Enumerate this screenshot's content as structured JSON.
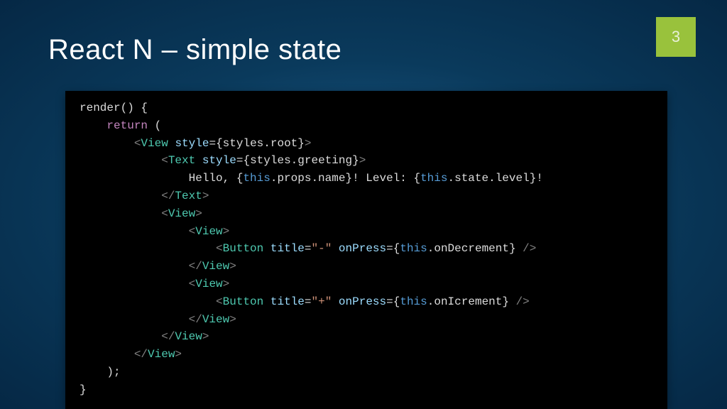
{
  "slide": {
    "title": "React N – simple state",
    "page_number": "3"
  },
  "code": {
    "lines": [
      [
        {
          "t": "render() {",
          "c": "text"
        }
      ],
      [
        {
          "t": "    ",
          "c": "text"
        },
        {
          "t": "return",
          "c": "kw-return"
        },
        {
          "t": " (",
          "c": "text"
        }
      ],
      [
        {
          "t": "        ",
          "c": "text"
        },
        {
          "t": "<",
          "c": "punct"
        },
        {
          "t": "View",
          "c": "component"
        },
        {
          "t": " ",
          "c": "text"
        },
        {
          "t": "style",
          "c": "attr"
        },
        {
          "t": "=",
          "c": "text"
        },
        {
          "t": "{styles.root}",
          "c": "text"
        },
        {
          "t": ">",
          "c": "punct"
        }
      ],
      [
        {
          "t": "            ",
          "c": "text"
        },
        {
          "t": "<",
          "c": "punct"
        },
        {
          "t": "Text",
          "c": "component"
        },
        {
          "t": " ",
          "c": "text"
        },
        {
          "t": "style",
          "c": "attr"
        },
        {
          "t": "=",
          "c": "text"
        },
        {
          "t": "{styles.greeting}",
          "c": "text"
        },
        {
          "t": ">",
          "c": "punct"
        }
      ],
      [
        {
          "t": "                Hello, {",
          "c": "text"
        },
        {
          "t": "this",
          "c": "this"
        },
        {
          "t": ".props.name}! Level: {",
          "c": "text"
        },
        {
          "t": "this",
          "c": "this"
        },
        {
          "t": ".state.level}!",
          "c": "text"
        }
      ],
      [
        {
          "t": "            ",
          "c": "text"
        },
        {
          "t": "</",
          "c": "punct"
        },
        {
          "t": "Text",
          "c": "component"
        },
        {
          "t": ">",
          "c": "punct"
        }
      ],
      [
        {
          "t": "            ",
          "c": "text"
        },
        {
          "t": "<",
          "c": "punct"
        },
        {
          "t": "View",
          "c": "component"
        },
        {
          "t": ">",
          "c": "punct"
        }
      ],
      [
        {
          "t": "                ",
          "c": "text"
        },
        {
          "t": "<",
          "c": "punct"
        },
        {
          "t": "View",
          "c": "component"
        },
        {
          "t": ">",
          "c": "punct"
        }
      ],
      [
        {
          "t": "                    ",
          "c": "text"
        },
        {
          "t": "<",
          "c": "punct"
        },
        {
          "t": "Button",
          "c": "component"
        },
        {
          "t": " ",
          "c": "text"
        },
        {
          "t": "title",
          "c": "attr"
        },
        {
          "t": "=",
          "c": "text"
        },
        {
          "t": "\"-\"",
          "c": "string"
        },
        {
          "t": " ",
          "c": "text"
        },
        {
          "t": "onPress",
          "c": "attr"
        },
        {
          "t": "=",
          "c": "text"
        },
        {
          "t": "{",
          "c": "text"
        },
        {
          "t": "this",
          "c": "this"
        },
        {
          "t": ".onDecrement} ",
          "c": "text"
        },
        {
          "t": "/>",
          "c": "punct"
        }
      ],
      [
        {
          "t": "                ",
          "c": "text"
        },
        {
          "t": "</",
          "c": "punct"
        },
        {
          "t": "View",
          "c": "component"
        },
        {
          "t": ">",
          "c": "punct"
        }
      ],
      [
        {
          "t": "                ",
          "c": "text"
        },
        {
          "t": "<",
          "c": "punct"
        },
        {
          "t": "View",
          "c": "component"
        },
        {
          "t": ">",
          "c": "punct"
        }
      ],
      [
        {
          "t": "                    ",
          "c": "text"
        },
        {
          "t": "<",
          "c": "punct"
        },
        {
          "t": "Button",
          "c": "component"
        },
        {
          "t": " ",
          "c": "text"
        },
        {
          "t": "title",
          "c": "attr"
        },
        {
          "t": "=",
          "c": "text"
        },
        {
          "t": "\"+\"",
          "c": "string"
        },
        {
          "t": " ",
          "c": "text"
        },
        {
          "t": "onPress",
          "c": "attr"
        },
        {
          "t": "=",
          "c": "text"
        },
        {
          "t": "{",
          "c": "text"
        },
        {
          "t": "this",
          "c": "this"
        },
        {
          "t": ".onIcrement} ",
          "c": "text"
        },
        {
          "t": "/>",
          "c": "punct"
        }
      ],
      [
        {
          "t": "                ",
          "c": "text"
        },
        {
          "t": "</",
          "c": "punct"
        },
        {
          "t": "View",
          "c": "component"
        },
        {
          "t": ">",
          "c": "punct"
        }
      ],
      [
        {
          "t": "            ",
          "c": "text"
        },
        {
          "t": "</",
          "c": "punct"
        },
        {
          "t": "View",
          "c": "component"
        },
        {
          "t": ">",
          "c": "punct"
        }
      ],
      [
        {
          "t": "        ",
          "c": "text"
        },
        {
          "t": "</",
          "c": "punct"
        },
        {
          "t": "View",
          "c": "component"
        },
        {
          "t": ">",
          "c": "punct"
        }
      ],
      [
        {
          "t": "    );",
          "c": "text"
        }
      ],
      [
        {
          "t": "}",
          "c": "text"
        }
      ]
    ]
  }
}
